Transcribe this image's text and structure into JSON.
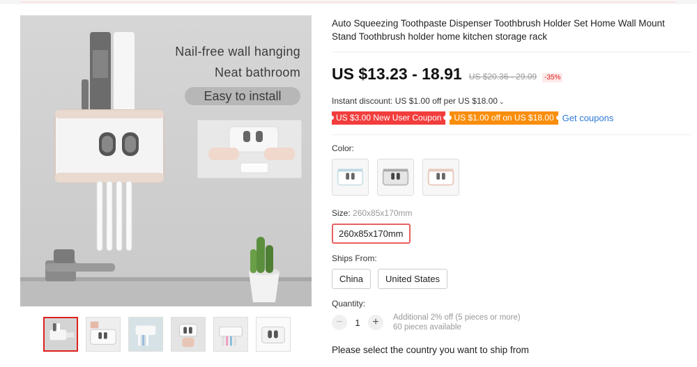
{
  "hero": {
    "line1": "Nail-free wall hanging",
    "line2": "Neat bathroom",
    "pill": "Easy to install"
  },
  "product": {
    "title": "Auto Squeezing Toothpaste Dispenser Toothbrush Holder Set Home Wall Mount Stand Toothbrush holder home kitchen storage rack",
    "price_current": "US $13.23 - 18.91",
    "price_old": "US $20.36 - 29.09",
    "discount_badge": "-35%"
  },
  "promo": {
    "instant_discount": "Instant discount: US $1.00 off per US $18.00",
    "coupon_new_user": "US $3.00 New User Coupon",
    "coupon_store": "US $1.00 off on US $18.00",
    "get_coupons": "Get coupons"
  },
  "options": {
    "color_label": "Color:",
    "size_label": "Size:",
    "size_selected_hint": "260x85x170mm",
    "size_option": "260x85x170mm",
    "ships_from_label": "Ships From:",
    "ships_from": [
      "China",
      "United States"
    ],
    "quantity_label": "Quantity:",
    "quantity_value": "1",
    "qty_info_line1": "Additional 2% off (5 pieces or more)",
    "qty_info_line2": "60 pieces available",
    "ship_country_prompt": "Please select the country you want to ship from"
  },
  "colors": {
    "accent_red": "#e02020",
    "coupon_red": "#f23d3d",
    "coupon_orange": "#f98e0d",
    "link_blue": "#2c7ad6"
  }
}
